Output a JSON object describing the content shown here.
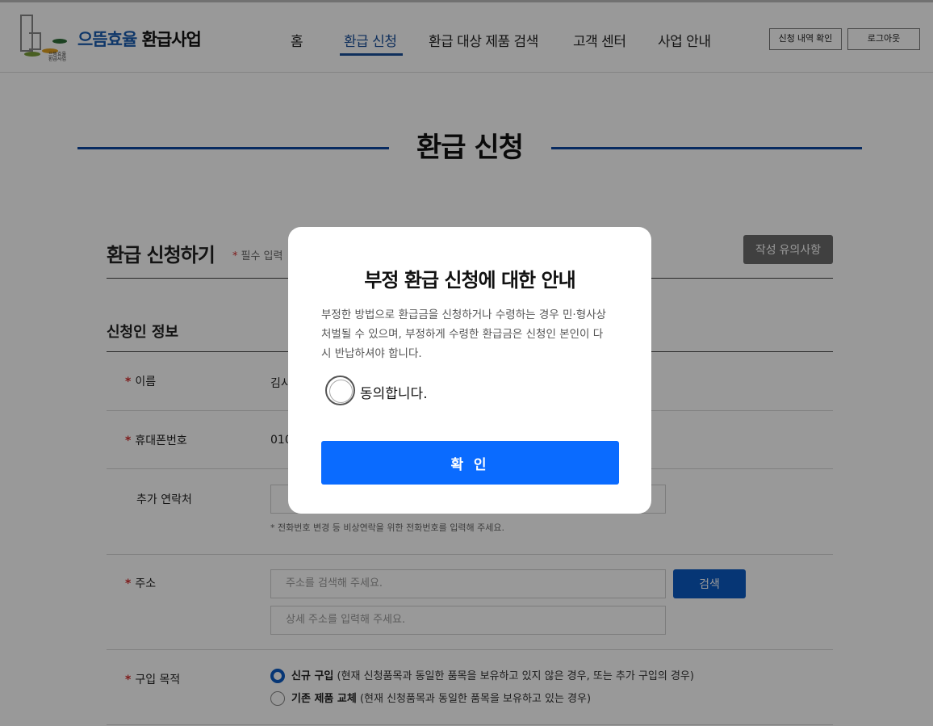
{
  "header": {
    "logo": {
      "brand_blue": "으뜸효율",
      "brand_dark": "환급사업",
      "mark_line1": "으뜸효율",
      "mark_line2": "환급사업"
    },
    "nav": [
      "홈",
      "환급 신청",
      "환급 대상 제품 검색",
      "고객 센터",
      "사업 안내"
    ],
    "active_nav": "환급 신청",
    "check_history_button": "신청 내역 확인",
    "logout_button": "로그아웃"
  },
  "page": {
    "title": "환급 신청",
    "section_title": "환급 신청하기",
    "required_note": "필수 입력",
    "notice_button": "작성 유의사항",
    "applicant_section": "신청인 정보",
    "fields": {
      "name_label": "이름",
      "name_value": "김시",
      "phone_label": "휴대폰번호",
      "phone_value": "010",
      "extra_contact_label": "추가 연락처",
      "extra_contact_hint": "* 전화번호 변경 등 비상연락을 위한 전화번호를 입력해 주세요.",
      "address_label": "주소",
      "address_placeholder": "주소를 검색해 주세요.",
      "address_detail_placeholder": "상세 주소를 입력해 주세요.",
      "address_search_button": "검색",
      "purpose_label": "구입 목적",
      "purpose_options": [
        {
          "title": "신규 구입",
          "desc": "(현재 신청품목과 동일한 품목을 보유하고 있지 않은 경우, 또는 추가 구입의 경우)",
          "selected": true
        },
        {
          "title": "기존 제품 교체",
          "desc": "(현재 신청품목과 동일한 품목을 보유하고 있는 경우)",
          "selected": false
        }
      ]
    }
  },
  "modal": {
    "title": "부정 환급 신청에 대한 안내",
    "body": "부정한 방법으로 환급금을 신청하거나 수령하는 경우 민·형사상 처벌될 수 있으며, 부정하게 수령한 환급금은 신청인 본인이 다시 반납하셔야 합니다.",
    "agree_label": "동의합니다.",
    "agree_checked": false,
    "confirm_button": "확 인"
  },
  "colors": {
    "primary_blue": "#0a6bff",
    "nav_active": "#1a4f99",
    "title_line": "#0d47a1",
    "required_star": "#d32f2f",
    "overlay": "rgba(0,0,0,0.4)"
  }
}
